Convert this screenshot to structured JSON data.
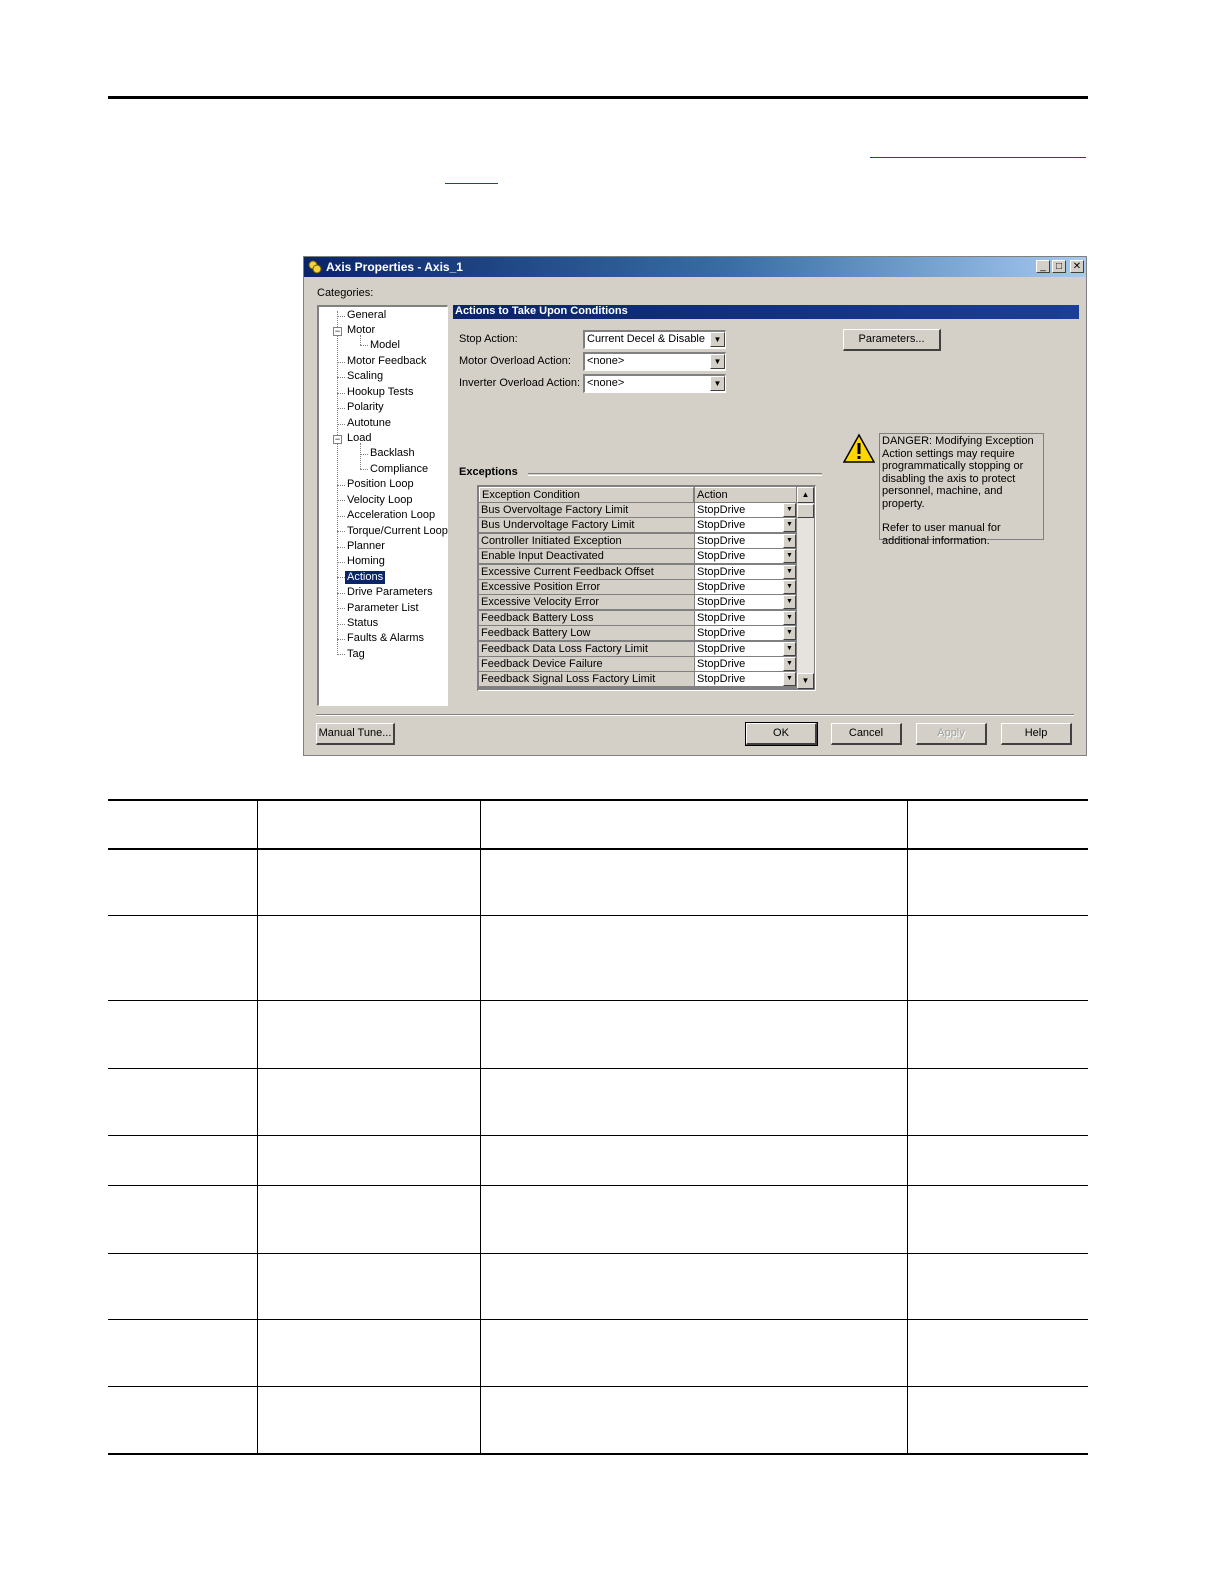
{
  "dialog": {
    "title": "Axis Properties - Axis_1",
    "window_buttons": {
      "minimize": "_",
      "maximize": "□",
      "close": "✕"
    },
    "categories_label": "Categories:",
    "tree": [
      {
        "label": "General"
      },
      {
        "label": "Motor",
        "expanded": true
      },
      {
        "label": "Model"
      },
      {
        "label": "Motor Feedback"
      },
      {
        "label": "Scaling"
      },
      {
        "label": "Hookup Tests"
      },
      {
        "label": "Polarity"
      },
      {
        "label": "Autotune"
      },
      {
        "label": "Load",
        "expanded": true
      },
      {
        "label": "Backlash"
      },
      {
        "label": "Compliance"
      },
      {
        "label": "Position Loop"
      },
      {
        "label": "Velocity Loop"
      },
      {
        "label": "Acceleration Loop"
      },
      {
        "label": "Torque/Current Loop"
      },
      {
        "label": "Planner"
      },
      {
        "label": "Homing"
      },
      {
        "label": "Actions",
        "selected": true
      },
      {
        "label": "Drive Parameters"
      },
      {
        "label": "Parameter List"
      },
      {
        "label": "Status"
      },
      {
        "label": "Faults & Alarms"
      },
      {
        "label": "Tag"
      }
    ],
    "section_title": "Actions to Take Upon Conditions",
    "stop_action_label": "Stop Action:",
    "stop_action_value": "Current Decel & Disable",
    "motor_overload_label": "Motor Overload Action:",
    "motor_overload_value": "<none>",
    "inverter_overload_label": "Inverter Overload Action:",
    "inverter_overload_value": "<none>",
    "parameters_button": "Parameters...",
    "exceptions_label": "Exceptions",
    "grid_headers": {
      "condition": "Exception Condition",
      "action": "Action"
    },
    "exceptions": [
      {
        "condition": "Bus Overvoltage Factory Limit",
        "action": "StopDrive"
      },
      {
        "condition": "Bus Undervoltage Factory Limit",
        "action": "StopDrive"
      },
      {
        "condition": "Controller Initiated Exception",
        "action": "StopDrive"
      },
      {
        "condition": "Enable Input Deactivated",
        "action": "StopDrive"
      },
      {
        "condition": "Excessive Current Feedback Offset",
        "action": "StopDrive"
      },
      {
        "condition": "Excessive Position Error",
        "action": "StopDrive"
      },
      {
        "condition": "Excessive Velocity Error",
        "action": "StopDrive"
      },
      {
        "condition": "Feedback Battery Loss",
        "action": "StopDrive"
      },
      {
        "condition": "Feedback Battery Low",
        "action": "StopDrive"
      },
      {
        "condition": "Feedback Data Loss Factory Limit",
        "action": "StopDrive"
      },
      {
        "condition": "Feedback Device Failure",
        "action": "StopDrive"
      },
      {
        "condition": "Feedback Signal Loss Factory Limit",
        "action": "StopDrive"
      }
    ],
    "danger_text": "DANGER: Modifying Exception Action settings may require programmatically stopping or disabling the axis to protect personnel, machine, and property.",
    "refer_text": "Refer to user manual for additional information.",
    "buttons": {
      "manual_tune": "Manual Tune...",
      "ok": "OK",
      "cancel": "Cancel",
      "apply": "Apply",
      "help": "Help"
    }
  },
  "colors": {
    "title_bar": "#0a246a",
    "dialog_bg": "#d4d0c8",
    "link": "#1a3fa8"
  }
}
